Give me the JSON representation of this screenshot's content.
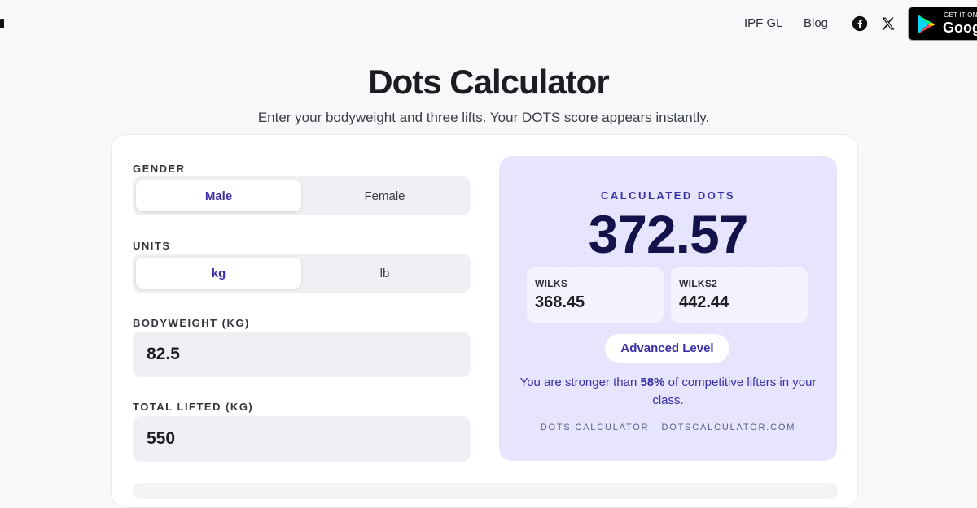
{
  "header": {
    "nav": [
      {
        "label": "IPF GL"
      },
      {
        "label": "Blog"
      }
    ],
    "social_icons": [
      "facebook-icon",
      "x-icon"
    ],
    "play_badge": {
      "small_text": "GET IT ON",
      "big_text": "Google Play"
    }
  },
  "page": {
    "title": "Dots Calculator",
    "subtitle": "Enter your bodyweight and three lifts. Your DOTS score appears instantly."
  },
  "form": {
    "gender": {
      "label": "GENDER",
      "options": [
        "Male",
        "Female"
      ],
      "selected": "Male"
    },
    "units": {
      "label": "UNITS",
      "options": [
        "kg",
        "lb"
      ],
      "selected": "kg"
    },
    "bodyweight": {
      "label": "BODYWEIGHT (KG)",
      "value": "82.5"
    },
    "total": {
      "label": "TOTAL LIFTED (KG)",
      "value": "550"
    }
  },
  "result": {
    "label": "CALCULATED DOTS",
    "score": "372.57",
    "wilks": {
      "label": "WILKS",
      "value": "368.45"
    },
    "wilks2": {
      "label": "WILKS2",
      "value": "442.44"
    },
    "level": "Advanced Level",
    "percentile_prefix": "You are stronger than ",
    "percentile_value": "58%",
    "percentile_suffix": " of competitive lifters in your class.",
    "watermark": "DOTS CALCULATOR · DOTSCALCULATOR.COM"
  },
  "colors": {
    "accent": "#3b2ea8",
    "score": "#14124a",
    "panel_bg": "#e7e4fd",
    "page_bg": "#f7f8f9"
  }
}
